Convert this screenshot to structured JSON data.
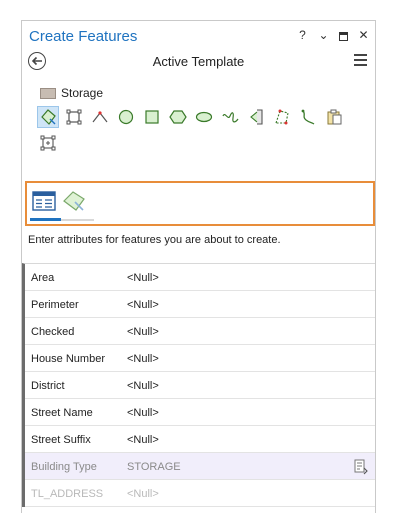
{
  "window": {
    "title": "Create Features",
    "help_label": "?",
    "options_label": "⌄",
    "close_label": "✕"
  },
  "header": {
    "title": "Active Template"
  },
  "template": {
    "name": "Storage",
    "swatch_color": "#c7bcb2"
  },
  "tools": [
    {
      "name": "polygon-tool",
      "selected": true
    },
    {
      "name": "rectangle-tool"
    },
    {
      "name": "right-angle-line-tool"
    },
    {
      "name": "circle-tool"
    },
    {
      "name": "square-tool"
    },
    {
      "name": "regular-polygon-tool"
    },
    {
      "name": "ellipse-tool"
    },
    {
      "name": "freehand-tool"
    },
    {
      "name": "autocomplete-polygon-tool"
    },
    {
      "name": "trace-tool"
    },
    {
      "name": "streaming-tool"
    },
    {
      "name": "clipboard-tool"
    },
    {
      "name": "point-by-point-tool"
    }
  ],
  "tabs": [
    {
      "name": "attributes-tab",
      "active": true
    },
    {
      "name": "template-tab",
      "active": false
    }
  ],
  "description": "Enter attributes for features you are about to create.",
  "attributes": [
    {
      "key": "Area",
      "value": "<Null>"
    },
    {
      "key": "Perimeter",
      "value": "<Null>"
    },
    {
      "key": "Checked",
      "value": "<Null>"
    },
    {
      "key": "House Number",
      "value": "<Null>"
    },
    {
      "key": "District",
      "value": "<Null>"
    },
    {
      "key": "Street Name",
      "value": "<Null>"
    },
    {
      "key": "Street Suffix",
      "value": "<Null>"
    },
    {
      "key": "Building Type",
      "value": "STORAGE"
    },
    {
      "key": "TL_ADDRESS",
      "value": "<Null>"
    }
  ],
  "colors": {
    "accent": "#1f73c0",
    "highlight_border": "#e88d3a",
    "subtype_row_bg": "#f1eefb"
  }
}
